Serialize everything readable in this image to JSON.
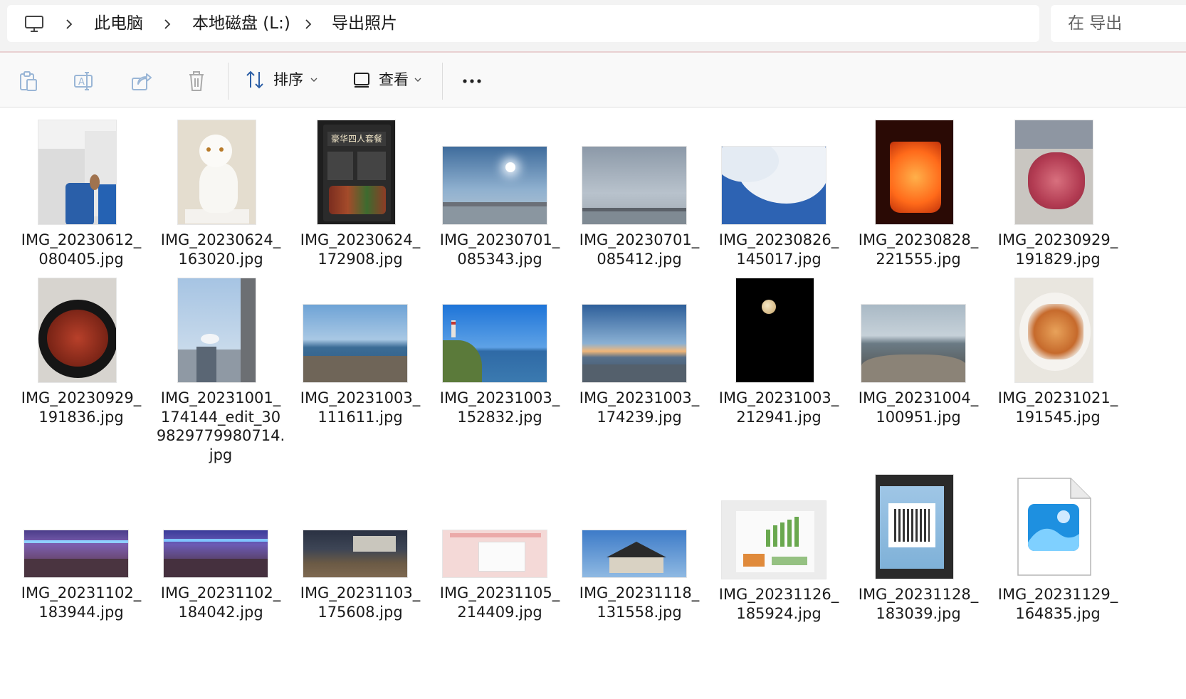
{
  "address_bar": {
    "breadcrumbs": [
      {
        "label": "此电脑"
      },
      {
        "label": "本地磁盘 (L:)"
      },
      {
        "label": "导出照片"
      }
    ],
    "search_placeholder": "在 导出"
  },
  "toolbar": {
    "sort_label": "排序",
    "view_label": "查看"
  },
  "files": [
    {
      "name": "IMG_20230612_\n080405.jpg",
      "thumb": "airplane-cabin"
    },
    {
      "name": "IMG_20230624_\n163020.jpg",
      "thumb": "cat-sculpture"
    },
    {
      "name": "IMG_20230624_\n172908.jpg",
      "thumb": "menu-board",
      "thumb_text": "豪华四人套餐"
    },
    {
      "name": "IMG_20230701_\n085343.jpg",
      "thumb": "sky-sun-bridge"
    },
    {
      "name": "IMG_20230701_\n085412.jpg",
      "thumb": "cloudy-bridge"
    },
    {
      "name": "IMG_20230826_\n145017.jpg",
      "thumb": "cloud-blue-sky"
    },
    {
      "name": "IMG_20230828_\n221555.jpg",
      "thumb": "orange-drink"
    },
    {
      "name": "IMG_20230929_\n191829.jpg",
      "thumb": "meat-dish"
    },
    {
      "name": "IMG_20230929_\n191836.jpg",
      "thumb": "crayfish-bowl"
    },
    {
      "name": "IMG_20231001_\n174144_edit_30\n9829779980714.\njpg",
      "thumb": "building-sky"
    },
    {
      "name": "IMG_20231003_\n111611.jpg",
      "thumb": "sea-rocks"
    },
    {
      "name": "IMG_20231003_\n152832.jpg",
      "thumb": "lighthouse-coast"
    },
    {
      "name": "IMG_20231003_\n174239.jpg",
      "thumb": "sunset-sea"
    },
    {
      "name": "IMG_20231003_\n212941.jpg",
      "thumb": "moon-night"
    },
    {
      "name": "IMG_20231004_\n100951.jpg",
      "thumb": "rocky-shore"
    },
    {
      "name": "IMG_20231021_\n191545.jpg",
      "thumb": "crab-plate"
    },
    {
      "name": "IMG_20231102_\n183944.jpg",
      "thumb": "market-night"
    },
    {
      "name": "IMG_20231102_\n184042.jpg",
      "thumb": "market-night-2"
    },
    {
      "name": "IMG_20231103_\n175608.jpg",
      "thumb": "parking-dusk"
    },
    {
      "name": "IMG_20231105_\n214409.jpg",
      "thumb": "receipt-bag"
    },
    {
      "name": "IMG_20231118_\n131558.jpg",
      "thumb": "pavilion-roof"
    },
    {
      "name": "IMG_20231126_\n185924.jpg",
      "thumb": "chart-paper"
    },
    {
      "name": "IMG_20231128_\n183039.jpg",
      "thumb": "qr-code-screen"
    },
    {
      "name": "IMG_20231129_\n164835.jpg",
      "thumb": "generic-image-file-icon"
    }
  ]
}
